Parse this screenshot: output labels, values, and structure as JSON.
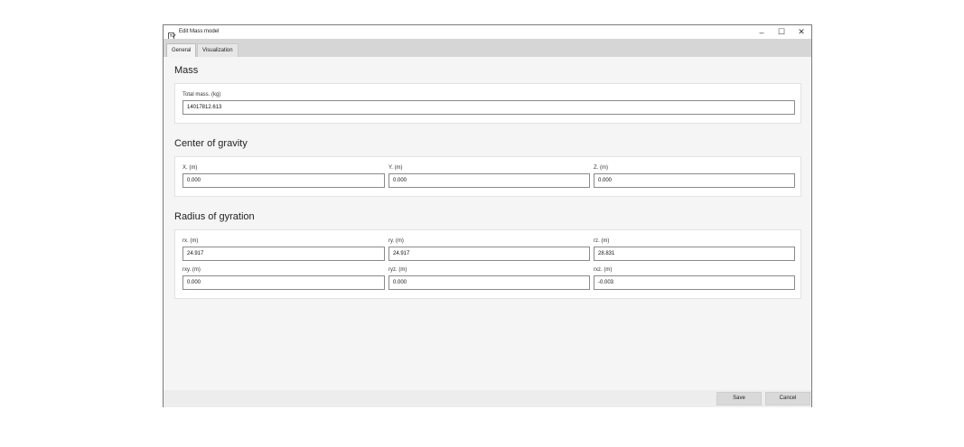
{
  "window": {
    "title": "Edit Mass model",
    "minimize_glyph": "–",
    "maximize_glyph": "☐",
    "close_glyph": "✕"
  },
  "tabs": [
    {
      "label": "General",
      "active": true
    },
    {
      "label": "Visualization",
      "active": false
    }
  ],
  "mass": {
    "title": "Mass",
    "total_label": "Total mass. (kg)",
    "total_value": "14017812.613"
  },
  "cog": {
    "title": "Center of gravity",
    "x_label": "X. (m)",
    "x_value": "0.000",
    "y_label": "Y. (m)",
    "y_value": "0.000",
    "z_label": "Z. (m)",
    "z_value": "0.000"
  },
  "gyration": {
    "title": "Radius of gyration",
    "rx_label": "rx. (m)",
    "rx_value": "24.917",
    "ry_label": "ry. (m)",
    "ry_value": "24.917",
    "rz_label": "rz. (m)",
    "rz_value": "28.831",
    "rxy_label": "rxy. (m)",
    "rxy_value": "0.000",
    "ryz_label": "ryz. (m)",
    "ryz_value": "0.000",
    "rxz_label": "rxz. (m)",
    "rxz_value": "-0.003"
  },
  "footer": {
    "save_label": "Save",
    "cancel_label": "Cancel"
  },
  "icons": {
    "app": "edit-document-icon"
  },
  "colors": {
    "tabbar_bg": "#d6d6d6",
    "content_bg": "#f5f5f5",
    "button_bg": "#d9d9d9"
  }
}
